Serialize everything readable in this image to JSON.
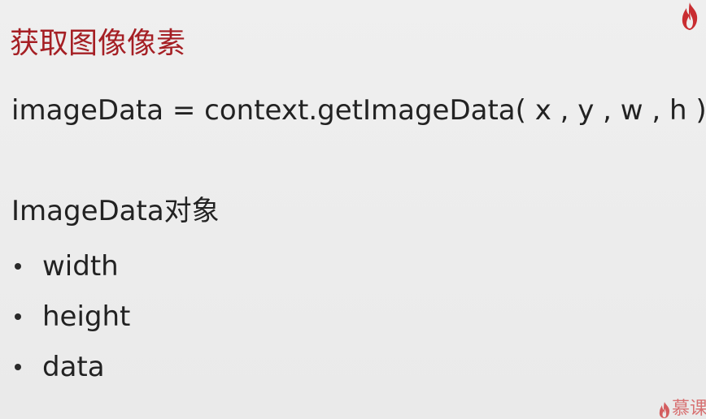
{
  "slide": {
    "title": "获取图像像素",
    "code_line": "imageData = context.getImageData( x , y , w , h )",
    "section_heading": "ImageData对象",
    "bullets": [
      "width",
      "height",
      "data"
    ]
  },
  "branding": {
    "top_icon": "flame-icon",
    "watermark_icon": "flame-icon",
    "watermark_text": "慕课",
    "accent_color": "#a51f24"
  }
}
